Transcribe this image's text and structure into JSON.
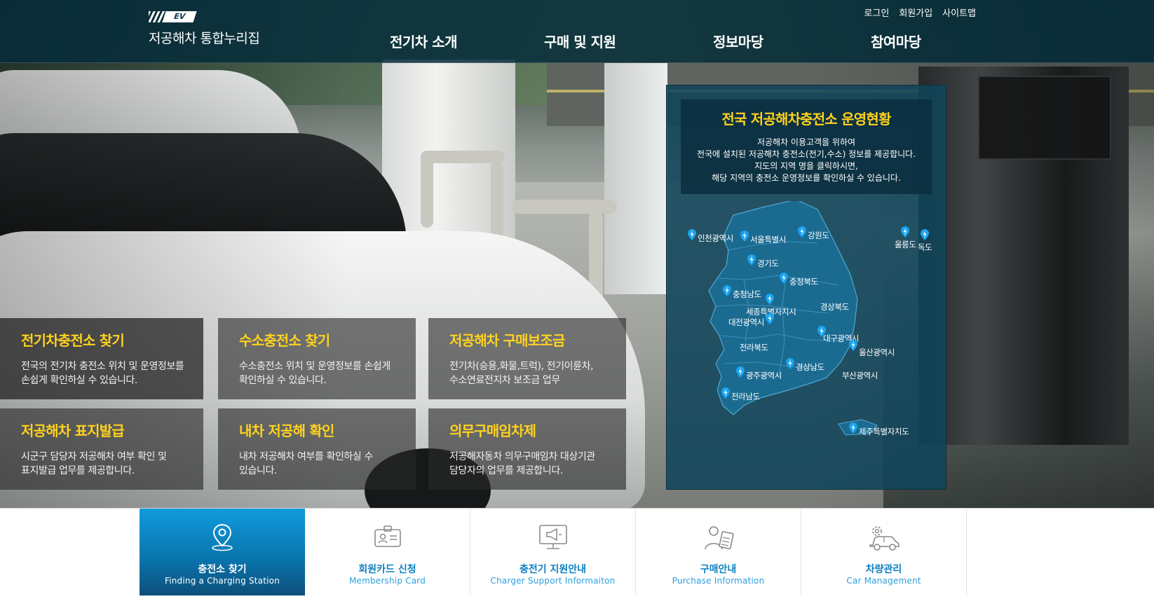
{
  "header": {
    "logo_badge": "EV",
    "logo_text": "저공해차 통합누리집",
    "util_links": [
      "로그인",
      "회원가입",
      "사이트맵"
    ],
    "nav": [
      "전기차 소개",
      "구매 및 지원",
      "정보마당",
      "참여마당"
    ]
  },
  "tiles": [
    {
      "title": "전기차충전소 찾기",
      "desc": "전국의 전기차 충전소 위치 및 운영정보를 손쉽게 확인하실 수 있습니다."
    },
    {
      "title": "수소충전소 찾기",
      "desc": "수소충전소 위치 및 운영정보를 손쉽게 확인하실 수 있습니다."
    },
    {
      "title": "저공해차 구매보조금",
      "desc": "전기차(승용,화물,트럭), 전기이륜차, 수소연료전지차 보조금 업무"
    },
    {
      "title": "저공해차 표지발급",
      "desc": "시군구 담당자 저공해차 여부 확인 및 표지발급 업무를 제공합니다."
    },
    {
      "title": "내차 저공해 확인",
      "desc": "내차 저공해차 여부를 확인하실 수 있습니다."
    },
    {
      "title": "의무구매임차제",
      "desc": "저공해자동차 의무구매임차 대상기관 담당자의 업무를 제공합니다."
    }
  ],
  "status_panel": {
    "title": "전국 저공해차충전소 운영현황",
    "desc_lines": [
      "저공해차 이용고객을 위하여",
      "전국에 설치된 저공해차 충전소(전기,수소) 정보를 제공합니다.",
      "지도의 지역 명을 클릭하시면,",
      "해당 지역의 충전소 운영정보를 확인하실 수 있습니다."
    ],
    "regions": [
      "인천광역시",
      "서울특별시",
      "강원도",
      "울릉도",
      "독도",
      "경기도",
      "충청북도",
      "충청남도",
      "세종특별자치시",
      "경상북도",
      "대전광역시",
      "전라북도",
      "대구광역시",
      "울산광역시",
      "경상남도",
      "광주광역시",
      "부산광역시",
      "전라남도",
      "제주특별자치도"
    ]
  },
  "quick_menu": [
    {
      "label": "충전소 찾기",
      "sub": "Finding a Charging Station",
      "icon": "location-pin-icon",
      "active": true
    },
    {
      "label": "회원카드 신청",
      "sub": "Membership Card",
      "icon": "id-card-icon",
      "active": false
    },
    {
      "label": "충전기 지원안내",
      "sub": "Charger Support Informaiton",
      "icon": "monitor-megaphone-icon",
      "active": false
    },
    {
      "label": "구매안내",
      "sub": "Purchase Information",
      "icon": "person-document-icon",
      "active": false
    },
    {
      "label": "차량관리",
      "sub": "Car Management",
      "icon": "car-gear-icon",
      "active": false
    }
  ],
  "colors": {
    "accent_yellow": "#ffd21e",
    "header_bg": "#062c3a",
    "panel_bg": "#10445a",
    "quick_blue": "#0b7fc2",
    "pin_blue": "#1aa3f0"
  }
}
